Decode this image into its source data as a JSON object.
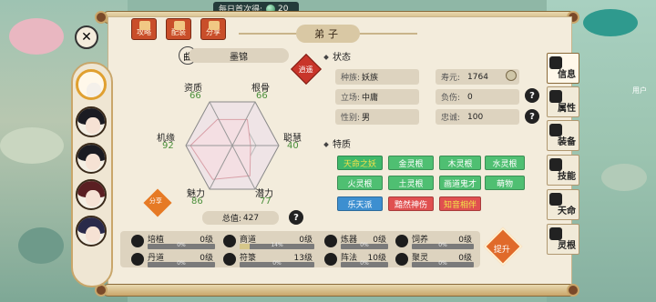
{
  "topbar": {
    "label": "每日首次得:",
    "value": "20"
  },
  "top_buttons": [
    {
      "label": "攻略"
    },
    {
      "label": "配装"
    },
    {
      "label": "分享"
    }
  ],
  "panel_title": "弟子",
  "disciple": {
    "name": "墨锦",
    "quality_icon": "曲",
    "badge": "逍遥",
    "total_label": "总值:",
    "total": "427",
    "share": "分享"
  },
  "stats": [
    {
      "label": "资质",
      "value": "66"
    },
    {
      "label": "根骨",
      "value": "66"
    },
    {
      "label": "机缘",
      "value": "92"
    },
    {
      "label": "聪慧",
      "value": "40"
    },
    {
      "label": "魅力",
      "value": "86"
    },
    {
      "label": "潜力",
      "value": "77"
    }
  ],
  "status": {
    "title": "状态",
    "race_label": "种族:",
    "race": "妖族",
    "lifespan_label": "寿元:",
    "lifespan": "1764",
    "stance_label": "立场:",
    "stance": "中庸",
    "burden_label": "负伤:",
    "burden": "0",
    "gender_label": "性别:",
    "gender": "男",
    "loyalty_label": "忠诚:",
    "loyalty": "100"
  },
  "traits": {
    "title": "特质",
    "items": [
      {
        "label": "天命之妖",
        "bg": "#3fb86a",
        "fg": "#f2e04a"
      },
      {
        "label": "金灵根",
        "bg": "#4fbf72",
        "fg": "#ffffff"
      },
      {
        "label": "木灵根",
        "bg": "#4fbf72",
        "fg": "#ffffff"
      },
      {
        "label": "水灵根",
        "bg": "#4fbf72",
        "fg": "#ffffff"
      },
      {
        "label": "火灵根",
        "bg": "#4fbf72",
        "fg": "#ffffff"
      },
      {
        "label": "土灵根",
        "bg": "#4fbf72",
        "fg": "#ffffff"
      },
      {
        "label": "画道鬼才",
        "bg": "#4fbf72",
        "fg": "#ffffff"
      },
      {
        "label": "萌物",
        "bg": "#4fbf72",
        "fg": "#ffffff"
      },
      {
        "label": "乐天派",
        "bg": "#3d8fd0",
        "fg": "#ffffff"
      },
      {
        "label": "黯然神伤",
        "bg": "#e05050",
        "fg": "#ffffff"
      },
      {
        "label": "知音相伴",
        "bg": "#e05050",
        "fg": "#f2e04a"
      }
    ]
  },
  "skills": [
    {
      "name": "培植",
      "level": "0级",
      "pct": "0%",
      "progress": 0
    },
    {
      "name": "商道",
      "level": "0级",
      "pct": "14%",
      "progress": 14
    },
    {
      "name": "炼器",
      "level": "0级",
      "pct": "0%",
      "progress": 0
    },
    {
      "name": "饲养",
      "level": "0级",
      "pct": "0%",
      "progress": 0
    },
    {
      "name": "丹道",
      "level": "0级",
      "pct": "0%",
      "progress": 0
    },
    {
      "name": "符箓",
      "level": "13级",
      "pct": "0%",
      "progress": 0
    },
    {
      "name": "阵法",
      "level": "10级",
      "pct": "0%",
      "progress": 0
    },
    {
      "name": "聚灵",
      "level": "0级",
      "pct": "0%",
      "progress": 0
    }
  ],
  "upgrade_label": "提升",
  "side_tabs": [
    {
      "label": "信息"
    },
    {
      "label": "属性"
    },
    {
      "label": "装备"
    },
    {
      "label": "技能"
    },
    {
      "label": "天命"
    },
    {
      "label": "灵根"
    }
  ],
  "user_label": "用户"
}
